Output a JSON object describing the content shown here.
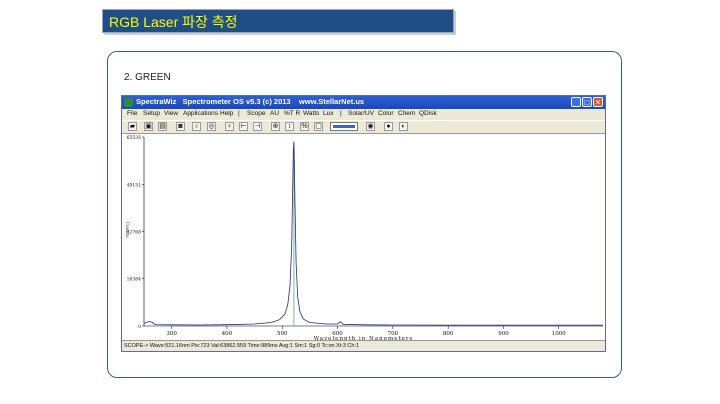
{
  "slide": {
    "title": "RGB Laser 파장 측정",
    "subtitle": "2. GREEN"
  },
  "window": {
    "title": "SpectraWiz   Spectrometer OS v5.3 (c) 2013    www.StellarNet.us",
    "buttons": [
      "_",
      "□",
      "✕"
    ]
  },
  "menu": [
    "File",
    "Setup",
    "View",
    "Applications",
    "Help",
    "|",
    "Scope",
    "AU",
    "%T R",
    "Watts",
    "Lux",
    "|",
    "Solar/UV",
    "Color",
    "Chem",
    "QDisk"
  ],
  "toolbar_icons": [
    "open-icon",
    "save-icon",
    "print-icon",
    "camera-icon",
    "bulb-icon",
    "target-icon",
    "bulb-icon",
    "cursor-left-icon",
    "cursor-right-icon",
    "zoom-icon",
    "measure-icon",
    "percent-icon",
    "clipboard-icon",
    "color-wheel-icon",
    "palette-icon"
  ],
  "status": "SCOPE-> Wave:521.16nm  Pix:723  Val:63862.559  Time:989ms  Avg:1  Sm:1  Sg:0  Tc:on  Xt:3  Ch:1",
  "chart_data": {
    "type": "line",
    "xlabel": "Wavelength in Nanometers",
    "ylabel": "Counts",
    "xlim": [
      250,
      1080
    ],
    "ylim": [
      0,
      65535
    ],
    "x_ticks": [
      300,
      400,
      500,
      600,
      700,
      800,
      900,
      1000
    ],
    "y_ticks": [
      0,
      16384,
      32768,
      49151,
      65535
    ],
    "peak_wavelength_nm": 521.16,
    "peak_value": 63862.559,
    "series": [
      {
        "color": "#1f2a8a",
        "x": [
          250,
          260,
          265,
          270,
          300,
          350,
          400,
          450,
          480,
          495,
          505,
          510,
          514,
          517,
          519,
          520,
          521,
          522,
          523,
          525,
          528,
          532,
          538,
          550,
          580,
          600,
          605,
          610,
          650,
          700,
          800,
          900,
          1000,
          1080
        ],
        "y": [
          900,
          1600,
          1200,
          500,
          400,
          350,
          450,
          700,
          1200,
          2200,
          4200,
          7500,
          14000,
          28000,
          50000,
          60500,
          63862,
          56000,
          42000,
          22000,
          10000,
          5000,
          2400,
          1200,
          700,
          700,
          1500,
          600,
          400,
          350,
          300,
          300,
          300,
          300
        ]
      }
    ],
    "cursor_x": 521.16
  }
}
